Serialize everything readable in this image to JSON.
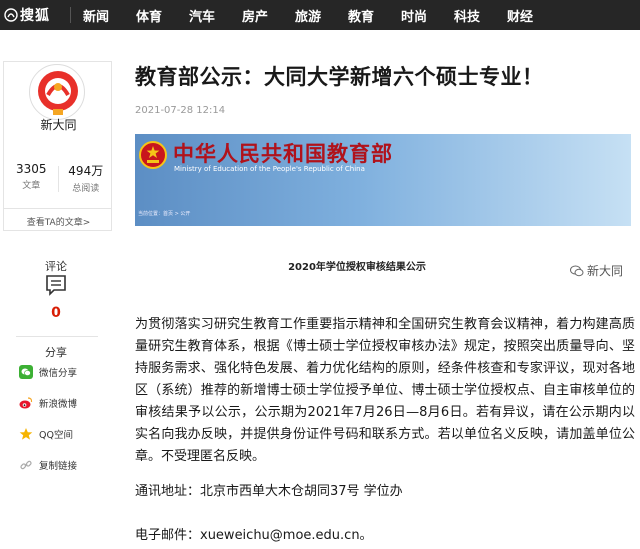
{
  "nav": {
    "brand": "搜狐",
    "items": [
      "新闻",
      "体育",
      "汽车",
      "房产",
      "旅游",
      "教育",
      "时尚",
      "科技",
      "财经"
    ]
  },
  "author": {
    "name": "新大同",
    "articles_count": "3305",
    "articles_label": "文章",
    "reads_count": "494万",
    "reads_label": "总阅读",
    "link_text": "查看TA的文章>"
  },
  "comments": {
    "label": "评论",
    "count": "0"
  },
  "share": {
    "label": "分享",
    "items": [
      {
        "label": "微信分享",
        "icon": "wechat-icon",
        "color": "#3cb034"
      },
      {
        "label": "新浪微博",
        "icon": "weibo-icon",
        "color": "#e6162d"
      },
      {
        "label": "QQ空间",
        "icon": "qzone-icon",
        "color": "#f6b400"
      },
      {
        "label": "复制链接",
        "icon": "link-icon",
        "color": "#bbbbbb"
      }
    ]
  },
  "article": {
    "title": "教育部公示：大同大学新增六个硕士专业！",
    "date": "2021-07-28 12:14",
    "banner_cn": "中华人民共和国教育部",
    "banner_en": "Ministry of Education of the People's Republic of China",
    "banner_crumb": "当前位置：首页 > 公开",
    "doc_title": "2020年学位授权审核结果公示",
    "watermark": "新大同",
    "paragraph": "为贯彻落实习研究生教育工作重要指示精神和全国研究生教育会议精神，着力构建高质量研究生教育体系，根据《博士硕士学位授权审核办法》规定，按照突出质量导向、坚持服务需求、强化特色发展、着力优化结构的原则，经条件核查和专家评议，现对各地区（系统）推荐的新增博士硕士学位授予单位、博士硕士学位授权点、自主审核单位的审核结果予以公示，公示期为2021年7月26日—8月6日。若有异议，请在公示期内以实名向我办反映，并提供身份证件号码和联系方式。若以单位名义反映，请加盖单位公章。不受理匿名反映。",
    "address": "通讯地址：北京市西单大木仓胡同37号 学位办",
    "email": "电子邮件：xueweichu@moe.edu.cn。"
  },
  "colors": {
    "nav_bg": "#262626",
    "accent_red": "#d81e06",
    "banner_red": "#b0121b"
  }
}
